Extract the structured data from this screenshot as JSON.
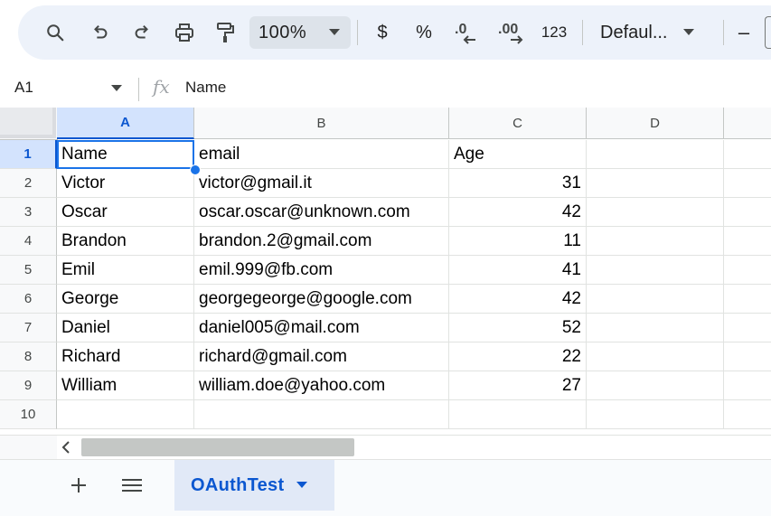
{
  "toolbar": {
    "zoom": "100%",
    "currency": "$",
    "percent": "%",
    "decrease_decimal": ".0",
    "increase_decimal": ".00",
    "number_format": "123",
    "font": "Defaul...",
    "minus": "–"
  },
  "formula_bar": {
    "cell_ref": "A1",
    "fx": "fx",
    "content": "Name"
  },
  "grid": {
    "columns": [
      "A",
      "B",
      "C",
      "D"
    ],
    "rows": [
      "1",
      "2",
      "3",
      "4",
      "5",
      "6",
      "7",
      "8",
      "9",
      "10"
    ],
    "data": [
      [
        "Name",
        "email",
        "Age"
      ],
      [
        "Victor",
        "victor@gmail.it",
        "31"
      ],
      [
        "Oscar",
        "oscar.oscar@unknown.com",
        "42"
      ],
      [
        "Brandon",
        "brandon.2@gmail.com",
        "11"
      ],
      [
        "Emil",
        "emil.999@fb.com",
        "41"
      ],
      [
        "George",
        "georgegeorge@google.com",
        "42"
      ],
      [
        "Daniel",
        "daniel005@mail.com",
        "52"
      ],
      [
        "Richard",
        "richard@gmail.com",
        "22"
      ],
      [
        "William",
        "william.doe@yahoo.com",
        "27"
      ],
      [
        "",
        "",
        ""
      ]
    ]
  },
  "sheets": {
    "active": "OAuthTest"
  },
  "colors": {
    "accent": "#0b57d0",
    "selection": "#1a73e8",
    "toolbar_bg": "#edf2fa"
  }
}
